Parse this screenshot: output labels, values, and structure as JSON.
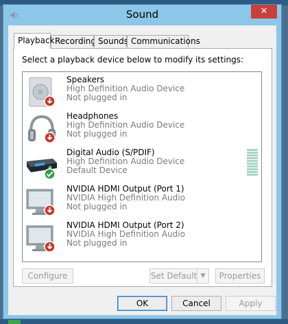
{
  "window": {
    "title": "Sound",
    "close_label": "✕"
  },
  "tabs": [
    {
      "label": "Playback",
      "active": true
    },
    {
      "label": "Recording",
      "active": false
    },
    {
      "label": "Sounds",
      "active": false
    },
    {
      "label": "Communications",
      "active": false
    }
  ],
  "panel": {
    "instruction": "Select a playback device below to modify its settings:"
  },
  "devices": [
    {
      "name": "Speakers",
      "driver": "High Definition Audio Device",
      "status": "Not plugged in",
      "icon": "speaker-icon",
      "badge": "red-down-arrow-icon"
    },
    {
      "name": "Headphones",
      "driver": "High Definition Audio Device",
      "status": "Not plugged in",
      "icon": "headphones-icon",
      "badge": "red-down-arrow-icon"
    },
    {
      "name": "Digital Audio (S/PDIF)",
      "driver": "High Definition Audio Device",
      "status": "Default Device",
      "icon": "digital-audio-receiver-icon",
      "badge": "green-check-icon",
      "selected": true
    },
    {
      "name": "NVIDIA HDMI Output (Port 1)",
      "driver": "NVIDIA High Definition Audio",
      "status": "Not plugged in",
      "icon": "monitor-icon",
      "badge": "red-down-arrow-icon"
    },
    {
      "name": "NVIDIA HDMI Output (Port 2)",
      "driver": "NVIDIA High Definition Audio",
      "status": "Not plugged in",
      "icon": "monitor-icon",
      "badge": "red-down-arrow-icon"
    }
  ],
  "buttons": {
    "configure": "Configure",
    "set_default": "Set Default",
    "properties": "Properties",
    "ok": "OK",
    "cancel": "Cancel",
    "apply": "Apply"
  },
  "colors": {
    "window_frame": "#8cc6e8",
    "close_button": "#c7403a",
    "status_red": "#c0392b",
    "status_green": "#2ea043"
  }
}
